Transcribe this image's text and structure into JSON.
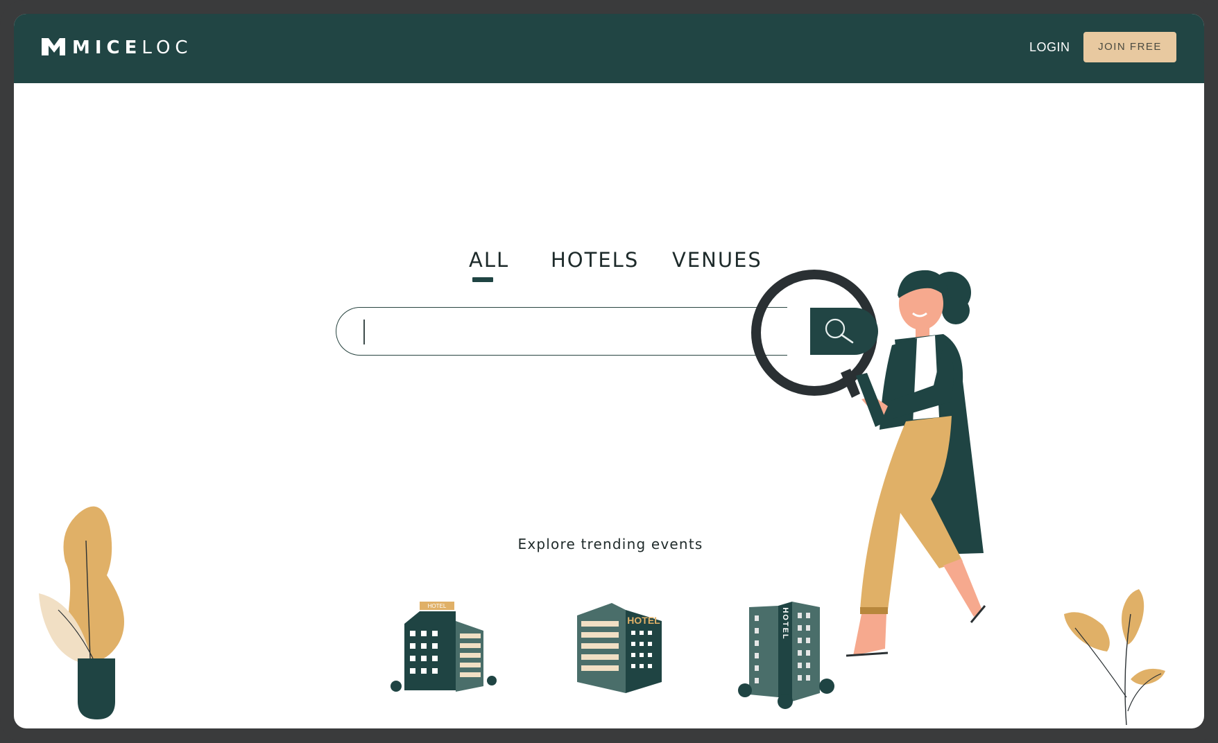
{
  "app": {
    "logo_text_bold": "MICE",
    "logo_text_light": "LOC"
  },
  "header": {
    "login_label": "LOGIN",
    "join_label": "JOIN FREE"
  },
  "search": {
    "tabs": [
      {
        "label": "ALL",
        "active": true
      },
      {
        "label": "HOTELS",
        "active": false
      },
      {
        "label": "VENUES",
        "active": false
      }
    ],
    "value": "",
    "placeholder": ""
  },
  "explore": {
    "heading": "Explore trending events",
    "items": [
      {
        "icon": "hotel-building-icon",
        "sign": "HOTEL"
      },
      {
        "icon": "hotel-building-icon",
        "sign": "HOTEL"
      },
      {
        "icon": "hotel-building-icon",
        "sign": "HOTEL"
      }
    ]
  },
  "colors": {
    "brand_dark": "#214544",
    "accent_sand": "#e8c9a0",
    "accent_mustard": "#e0b067",
    "frame": "#3a3b3c"
  }
}
